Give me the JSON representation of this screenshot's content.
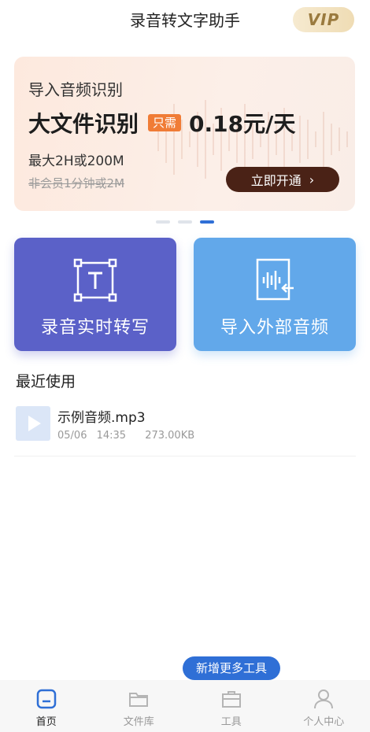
{
  "header": {
    "title": "录音转文字助手",
    "vip": "VIP"
  },
  "banner": {
    "line1": "导入音频识别",
    "headline": "大文件识别",
    "tag": "只需",
    "price": "0.18元/天",
    "limit": "最大2H或200M",
    "non_member": "非会员1分钟或2M",
    "cta": "立即开通"
  },
  "carousel": {
    "count": 3,
    "active_index": 2
  },
  "features": {
    "left_label": "录音实时转写",
    "right_label": "导入外部音频"
  },
  "recent": {
    "title": "最近使用",
    "items": [
      {
        "name": "示例音频.mp3",
        "date": "05/06",
        "time": "14:35",
        "size": "273.00KB"
      }
    ]
  },
  "tooltip": "新增更多工具",
  "nav": [
    {
      "label": "首页",
      "icon": "home-icon",
      "active": true
    },
    {
      "label": "文件库",
      "icon": "folder-icon",
      "active": false
    },
    {
      "label": "工具",
      "icon": "toolbox-icon",
      "active": false
    },
    {
      "label": "个人中心",
      "icon": "user-icon",
      "active": false
    }
  ],
  "colors": {
    "accent": "#2f6fd6",
    "card_left": "#5b61c8",
    "card_right": "#62a8ea",
    "cta": "#4a2216",
    "tag": "#f07c36"
  }
}
